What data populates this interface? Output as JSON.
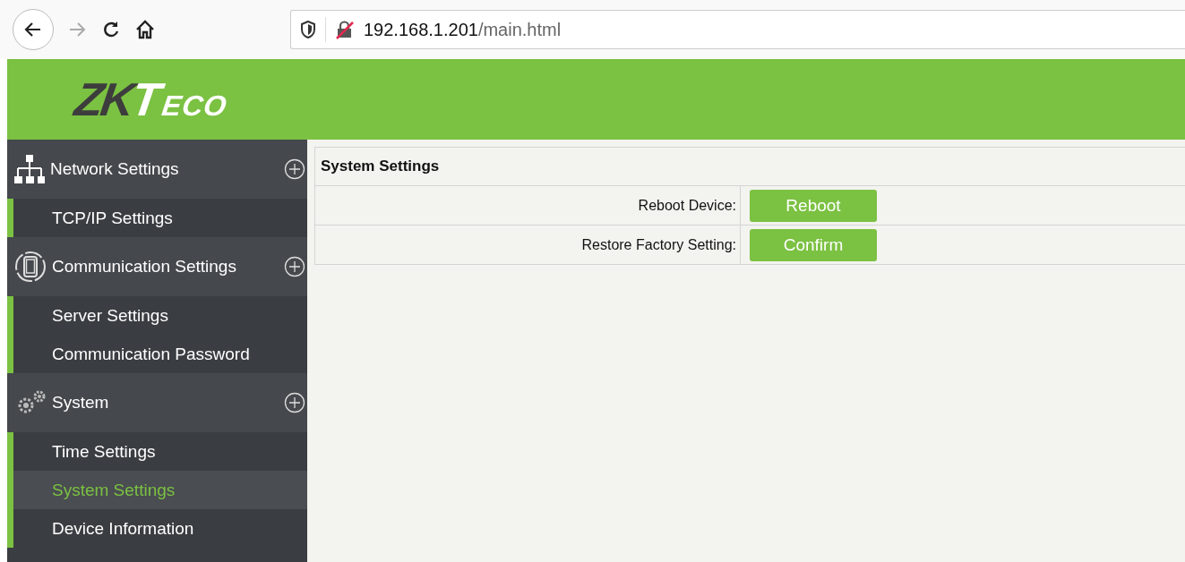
{
  "browser": {
    "url_host": "192.168.1.201",
    "url_path": "/main.html"
  },
  "logo": {
    "dark": "ZK",
    "light": "T",
    "small": "ECO"
  },
  "sidebar": {
    "groups": [
      {
        "label": "Network Settings",
        "kind": "network",
        "expanded": true,
        "items": [
          {
            "label": "TCP/IP Settings",
            "selected": false
          }
        ]
      },
      {
        "label": "Communication Settings",
        "kind": "phone",
        "expanded": true,
        "items": [
          {
            "label": "Server Settings",
            "selected": false
          },
          {
            "label": "Communication Password",
            "selected": false
          }
        ]
      },
      {
        "label": "System",
        "kind": "gears",
        "expanded": true,
        "items": [
          {
            "label": "Time Settings",
            "selected": false
          },
          {
            "label": "System Settings",
            "selected": true
          },
          {
            "label": "Device Information",
            "selected": false
          }
        ]
      }
    ]
  },
  "panel": {
    "title": "System Settings",
    "rows": [
      {
        "label": "Reboot Device:",
        "button": "Reboot"
      },
      {
        "label": "Restore Factory Setting:",
        "button": "Confirm"
      }
    ]
  }
}
